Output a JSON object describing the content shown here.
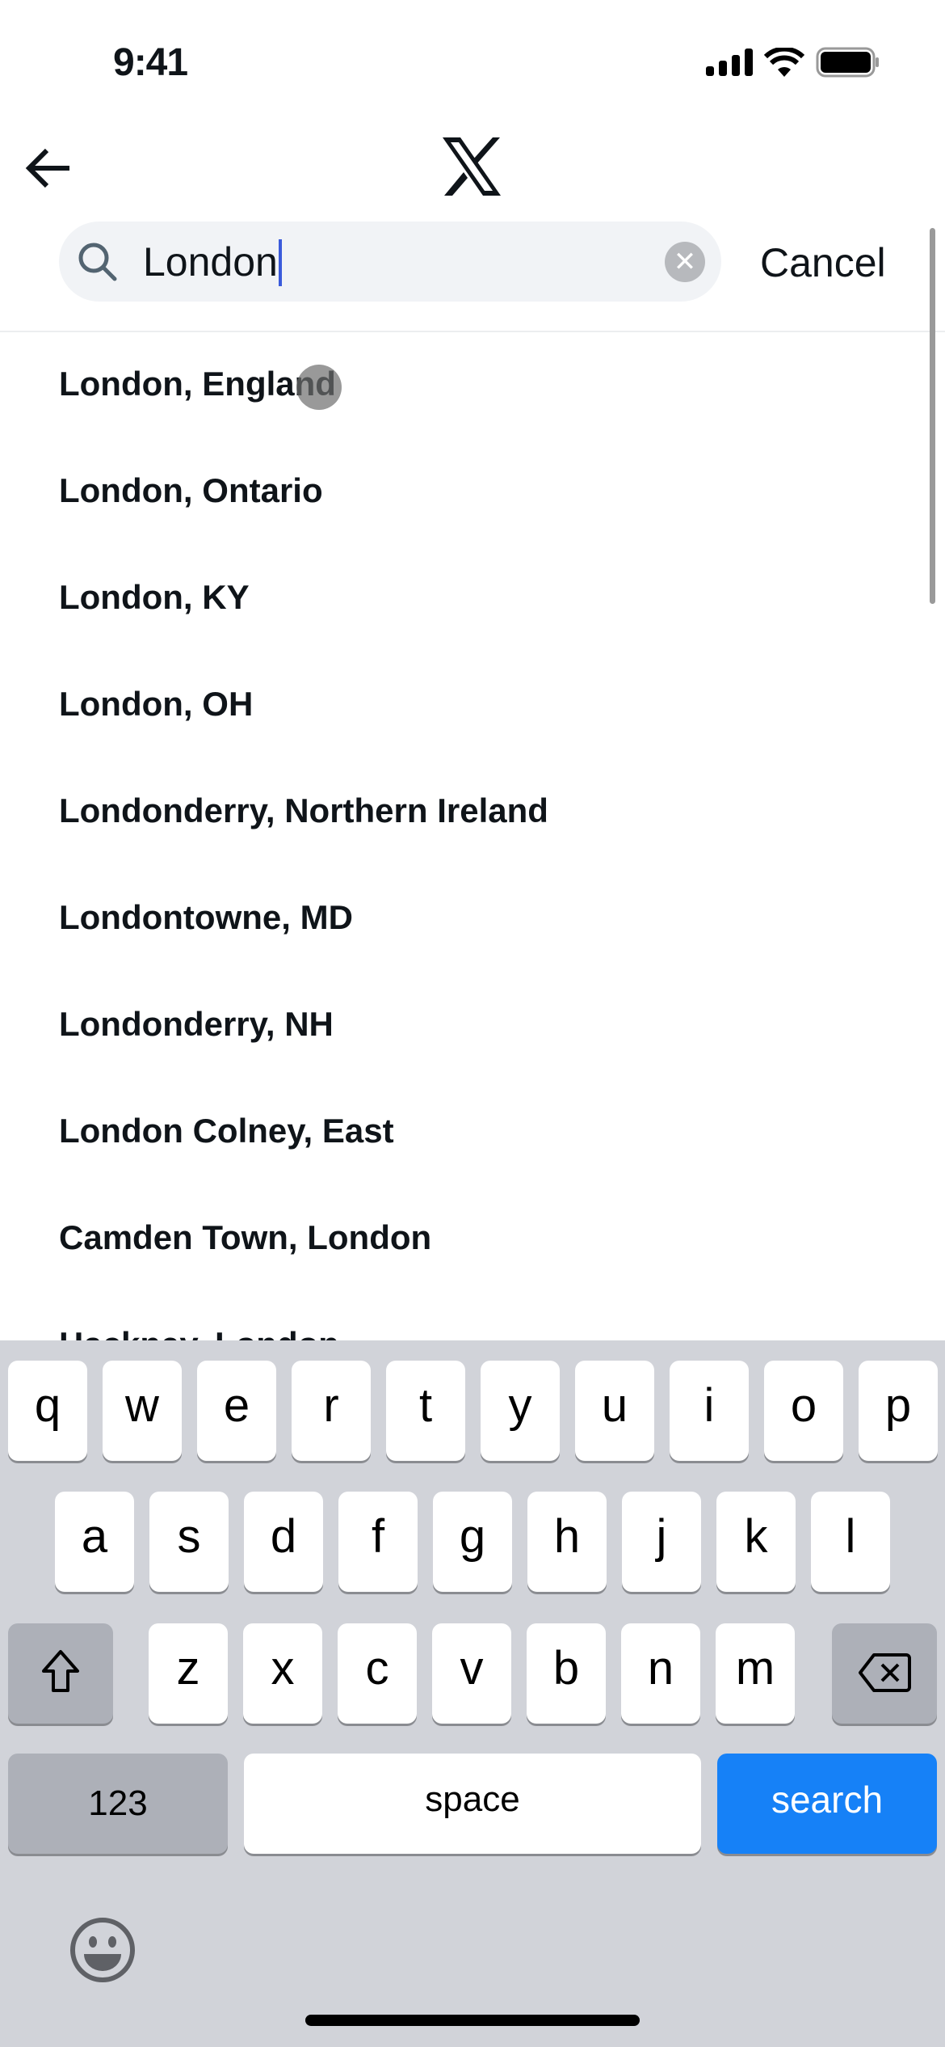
{
  "status_bar": {
    "time": "9:41",
    "icons": [
      "cellular-signal-icon",
      "wifi-icon",
      "battery-icon"
    ]
  },
  "header": {
    "back_icon": "arrow-left-icon",
    "logo": "X"
  },
  "search": {
    "value": "London",
    "icon": "search-icon",
    "clear_icon": "clear-icon",
    "cancel_label": "Cancel"
  },
  "results": [
    "London, England",
    "London, Ontario",
    "London, KY",
    "London, OH",
    "Londonderry, Northern Ireland",
    "Londontowne, MD",
    "Londonderry, NH",
    "London Colney, East",
    "Camden Town, London",
    "Hackney, London"
  ],
  "keyboard": {
    "row1": [
      "q",
      "w",
      "e",
      "r",
      "t",
      "y",
      "u",
      "i",
      "o",
      "p"
    ],
    "row2": [
      "a",
      "s",
      "d",
      "f",
      "g",
      "h",
      "j",
      "k",
      "l"
    ],
    "row3": [
      "z",
      "x",
      "c",
      "v",
      "b",
      "n",
      "m"
    ],
    "numbers_label": "123",
    "space_label": "space",
    "search_label": "search",
    "search_color": "#1681f7"
  }
}
